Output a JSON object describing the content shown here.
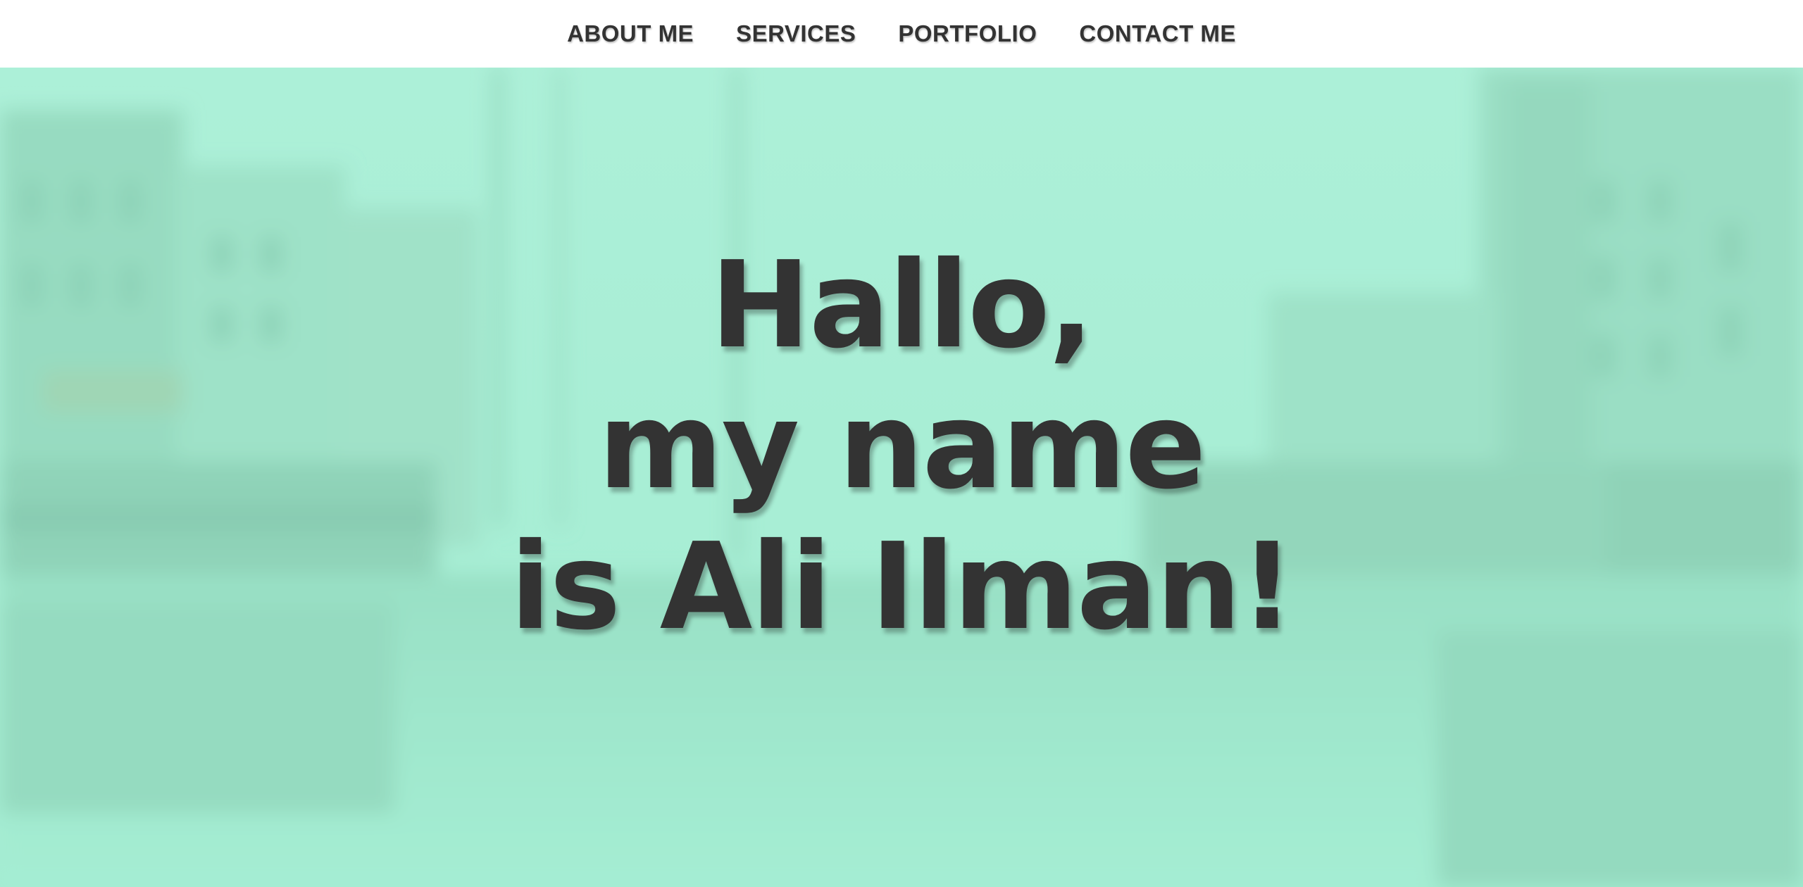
{
  "nav": {
    "items": [
      {
        "label": "ABOUT ME"
      },
      {
        "label": "SERVICES"
      },
      {
        "label": "PORTFOLIO"
      },
      {
        "label": "CONTACT ME"
      }
    ]
  },
  "hero": {
    "line1": "Hallo,",
    "line2": "my name",
    "line3": "is Ali Ilman!",
    "background": "blurred canal street photo with mint green overlay",
    "overlay_color": "#a4eed4",
    "text_color": "#333333"
  }
}
